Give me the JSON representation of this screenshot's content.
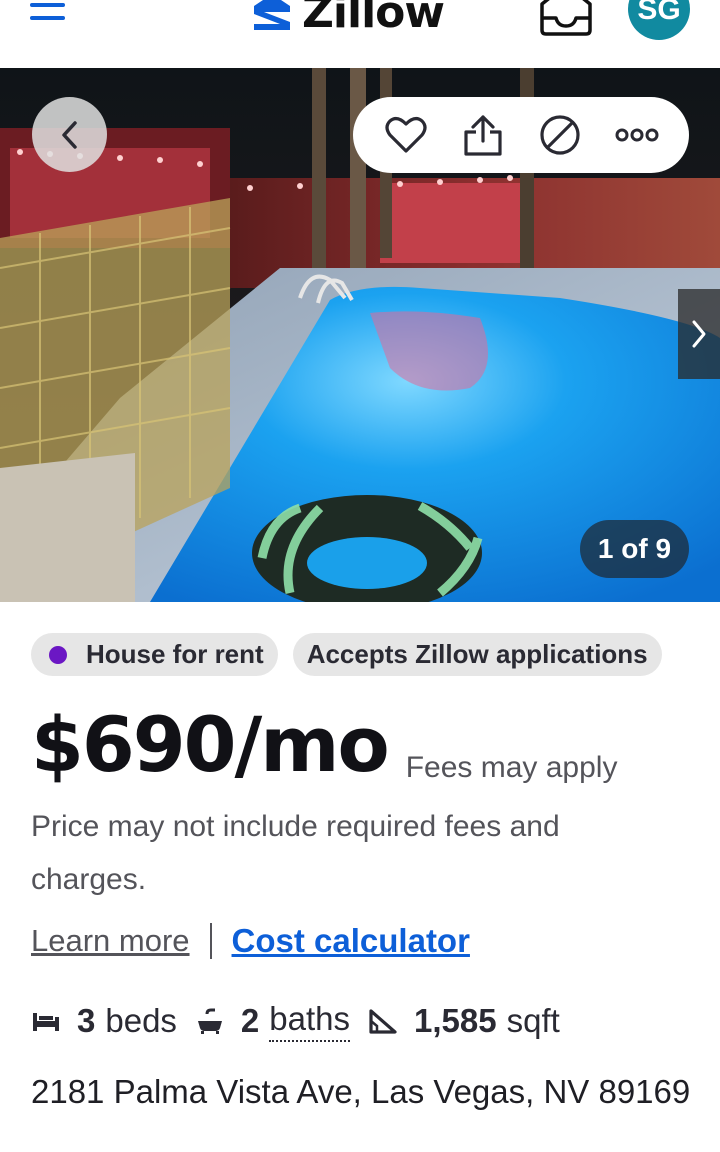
{
  "header": {
    "logo_text": "Zillow",
    "avatar_initials": "SG",
    "brand_color": "#0d5fd8",
    "avatar_color": "#118aa0"
  },
  "photo": {
    "counter_text": "1 of 9",
    "icons": [
      "back-arrow-icon",
      "heart-icon",
      "share-icon",
      "hide-icon",
      "more-icon",
      "next-arrow-icon"
    ]
  },
  "badges": {
    "listing_type": "House for rent",
    "applications": "Accepts Zillow applications",
    "status_dot_color": "#6b17c4"
  },
  "price": {
    "amount": "$690/mo",
    "fees_note": "Fees may apply",
    "disclaimer": "Price may not include required fees and charges."
  },
  "links": {
    "learn_more": "Learn more",
    "cost_calculator": "Cost calculator"
  },
  "facts": {
    "beds_value": "3",
    "beds_label": "beds",
    "baths_value": "2",
    "baths_label": "baths",
    "sqft_value": "1,585",
    "sqft_label": "sqft"
  },
  "address": "2181 Palma Vista Ave, Las Vegas, NV 89169"
}
